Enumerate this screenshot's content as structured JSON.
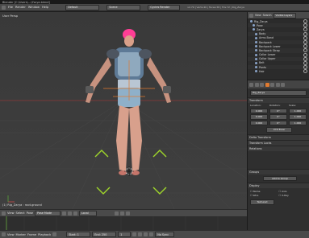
{
  "window": {
    "title": "Blender [C:\\Users\\...\\Zarya.blend]"
  },
  "topmenu": {
    "menus": [
      "File",
      "Render",
      "Window",
      "Help"
    ],
    "layout": "Default",
    "scene": "Scene",
    "engine": "Cycles Render",
    "stats": "v2.79 | Verts:40 | Faces:38 | Tris:72 | Rig_Zarya"
  },
  "viewport": {
    "view_label": "User Persp",
    "object_label": "(1) Rig_Zarya : root.ground"
  },
  "viewport_header": {
    "items": [
      "View",
      "Select",
      "Pose"
    ],
    "mode": "Pose Mode",
    "pivot": "Local"
  },
  "outliner": {
    "header": {
      "view": "View",
      "search": "Search",
      "filter": "Visible Layers"
    },
    "rows": [
      "Rig_Zarya",
      "Pose",
      "Zarya",
      "Body",
      "Arms Band",
      "Backpack",
      "Backpack Lower",
      "Backpack Strap",
      "Collar Lower",
      "Collar Upper",
      "Belt",
      "Pants",
      "Hair"
    ]
  },
  "properties": {
    "object_name": "Rig_Zarya",
    "transform_label": "Transform",
    "location_label": "Location:",
    "rotation_label": "Rotation:",
    "scale_label": "Scale:",
    "location": [
      "0.000",
      "0.000",
      "0.000"
    ],
    "rotation": [
      "0°",
      "0°",
      "0°"
    ],
    "scale": [
      "1.000",
      "1.000",
      "1.000"
    ],
    "rotation_mode": "XYZ Euler",
    "panels": [
      "Delta Transform",
      "Transform Locks",
      "Relations",
      "Groups",
      "Display"
    ],
    "groups_add": "Add to Group",
    "display_items": [
      "Name",
      "Axis",
      "Wire",
      "X-Ray"
    ],
    "display_type": "Textured"
  },
  "timeline": {
    "items": [
      "View",
      "Marker",
      "Frame",
      "Playback"
    ],
    "start_label": "Start:",
    "start": "1",
    "end_label": "End:",
    "end": "250",
    "current": "1",
    "sync": "No Sync"
  },
  "colors": {
    "accent": "#e07a2f",
    "bone_green": "#9fd62a",
    "hair": "#ff3d95"
  }
}
